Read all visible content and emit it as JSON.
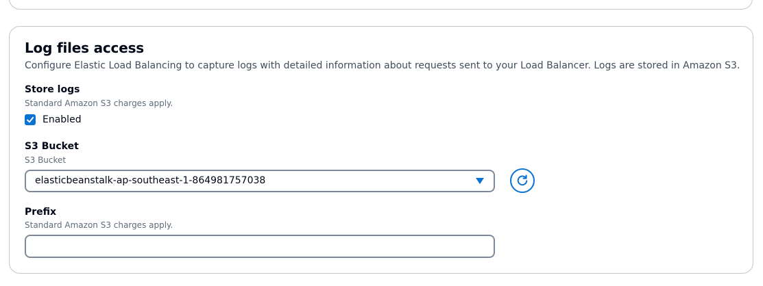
{
  "section": {
    "title": "Log files access",
    "description": "Configure Elastic Load Balancing to capture logs with detailed information about requests sent to your Load Balancer. Logs are stored in Amazon S3."
  },
  "store_logs": {
    "label": "Store logs",
    "hint": "Standard Amazon S3 charges apply.",
    "checkbox_label": "Enabled",
    "checked": true
  },
  "s3_bucket": {
    "label": "S3 Bucket",
    "hint": "S3 Bucket",
    "selected_value": "elasticbeanstalk-ap-southeast-1-864981757038"
  },
  "prefix": {
    "label": "Prefix",
    "hint": "Standard Amazon S3 charges apply.",
    "value": "",
    "placeholder": ""
  },
  "icons": {
    "check": "check-icon",
    "caret": "caret-down-icon",
    "refresh": "refresh-icon"
  },
  "colors": {
    "accent": "#0972d3",
    "border": "#7d8998",
    "panel_border": "#c6c6cd"
  }
}
